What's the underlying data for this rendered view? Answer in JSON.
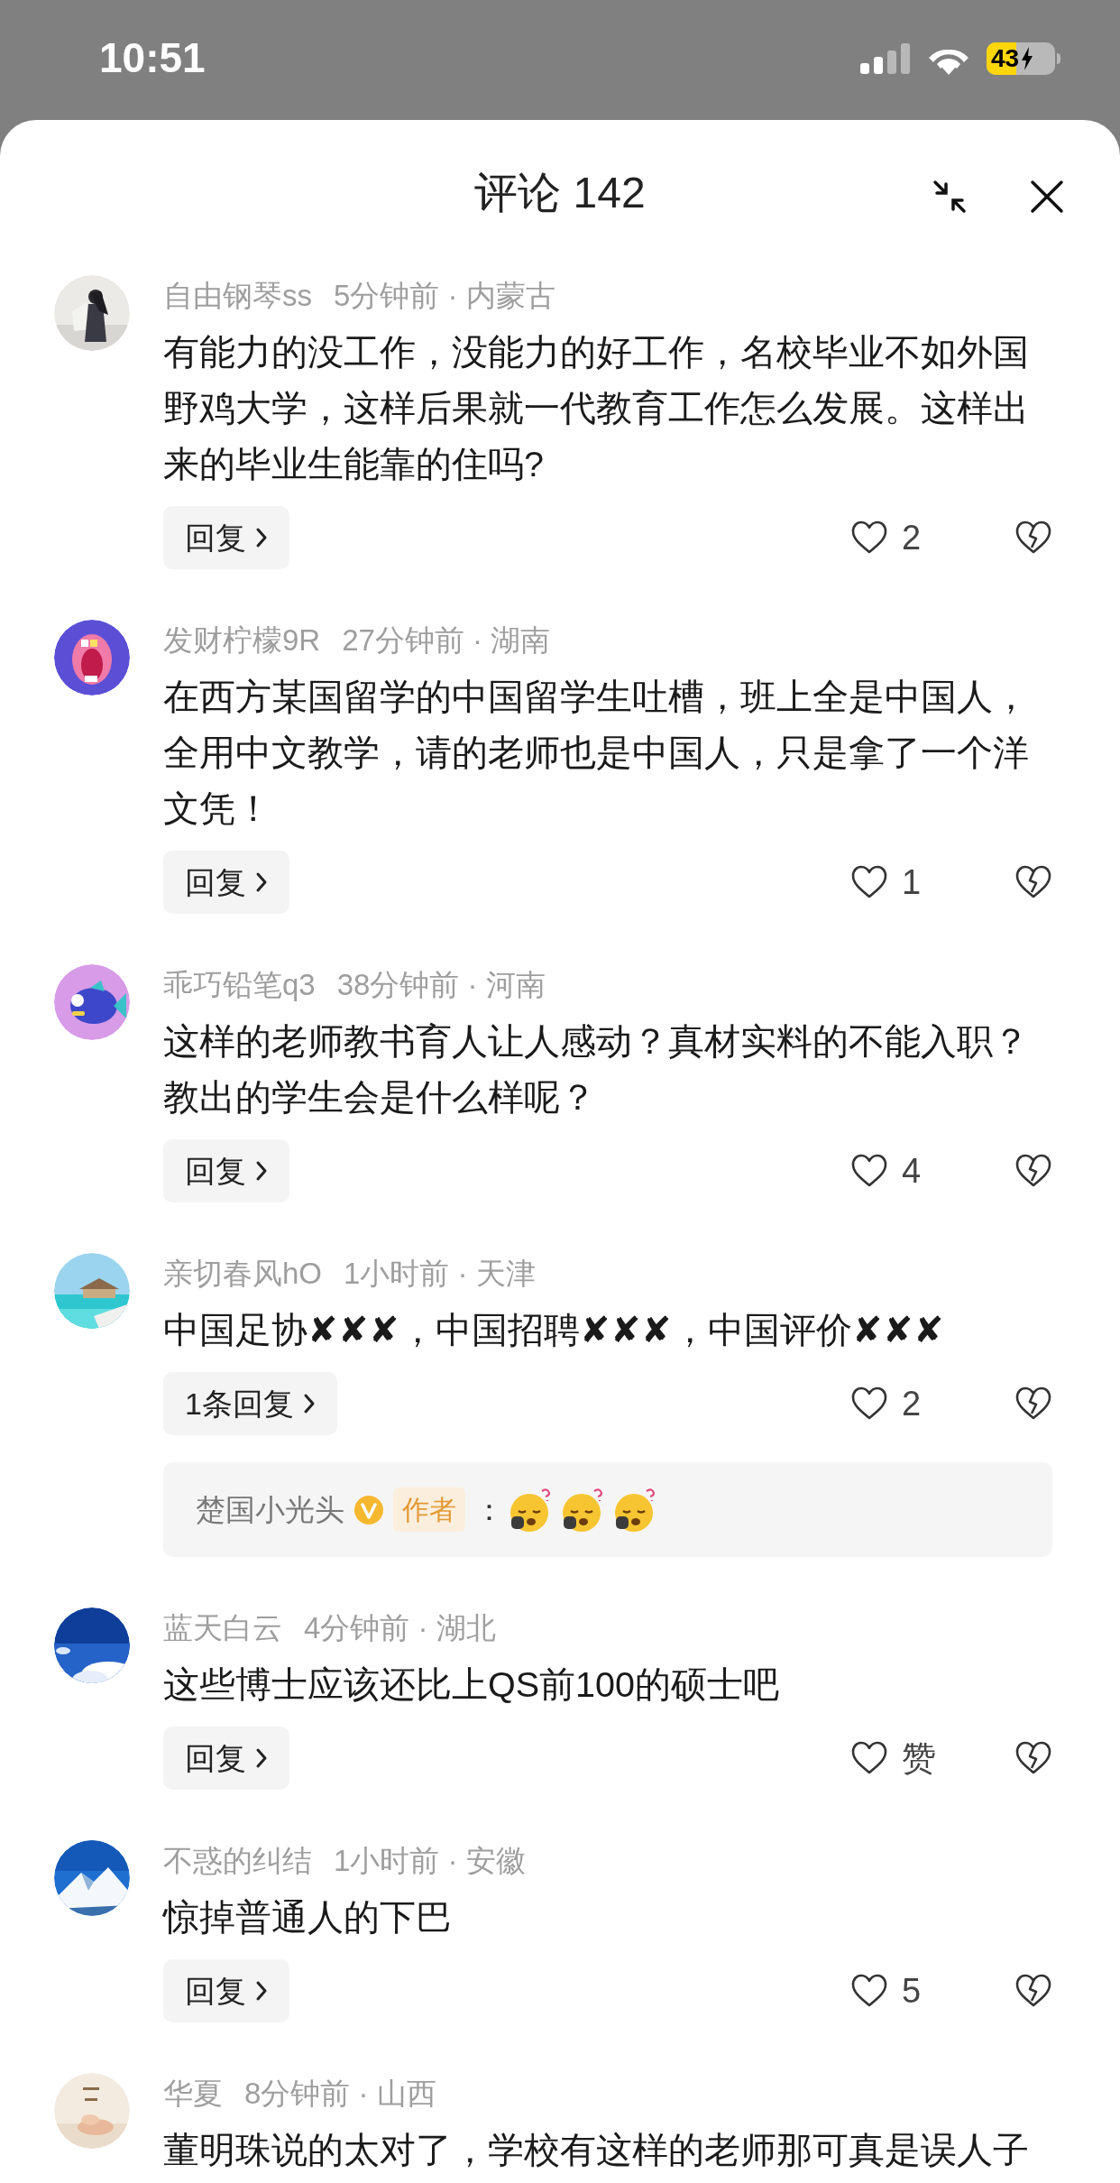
{
  "status_bar": {
    "time": "10:51",
    "battery": "43"
  },
  "header": {
    "title": "评论 142"
  },
  "comments": [
    {
      "name": "自由钢琴ss",
      "meta": "5分钟前 · 内蒙古",
      "text": "有能力的没工作，没能力的好工作，名校毕业不如外国野鸡大学，这样后果就一代教育工作怎么发展。这样出来的毕业生能靠的住吗?",
      "reply_button": "回复",
      "likes": "2"
    },
    {
      "name": "发财柠檬9R",
      "meta": "27分钟前 · 湖南",
      "text": "在西方某国留学的中国留学生吐槽，班上全是中国人，全用中文教学，请的老师也是中国人，只是拿了一个洋文凭！",
      "reply_button": "回复",
      "likes": "1"
    },
    {
      "name": "乖巧铅笔q3",
      "meta": "38分钟前 · 河南",
      "text": "这样的老师教书育人让人感动？真材实料的不能入职？教出的学生会是什么样呢？",
      "reply_button": "回复",
      "likes": "4"
    },
    {
      "name": "亲切春风hO",
      "meta": "1小时前 · 天津",
      "text": "中国足协✘✘✘，中国招聘✘✘✘，中国评价✘✘✘",
      "reply_button": "1条回复",
      "likes": "2",
      "sub_replies": [
        {
          "name": "楚国小光头",
          "verified": true,
          "badge": "作者",
          "separator": "：",
          "stickers": [
            {
              "kind": "sleepy"
            },
            {
              "kind": "sleepy"
            },
            {
              "kind": "sleepy"
            }
          ]
        }
      ]
    },
    {
      "name": "蓝天白云",
      "meta": "4分钟前 · 湖北",
      "text": "这些博士应该还比上QS前100的硕士吧",
      "reply_button": "回复",
      "likes": "赞"
    },
    {
      "name": "不惑的纠结",
      "meta": "1小时前 · 安徽",
      "text": "惊掉普通人的下巴",
      "reply_button": "回复",
      "likes": "5"
    },
    {
      "name": "华夏",
      "meta": "8分钟前 · 山西",
      "text": "董明珠说的太对了，学校有这样的老师那可真是误人子"
    }
  ]
}
